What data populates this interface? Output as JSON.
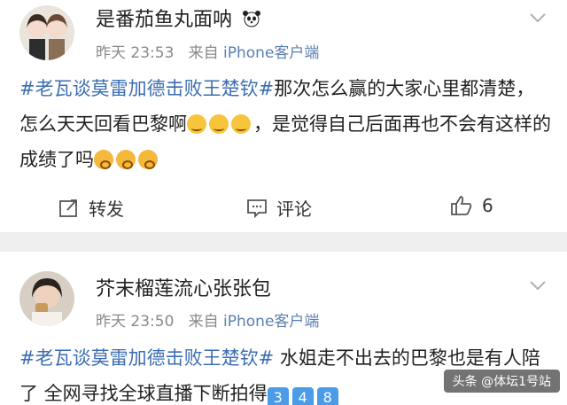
{
  "posts": [
    {
      "username": "是番茄鱼丸面呐",
      "time": "昨天 23:53",
      "source_prefix": "来自",
      "client": "iPhone客户端",
      "hashtag": "#老瓦谈莫雷加德击败王楚钦#",
      "text_a": "那次怎么赢的大家心里都清楚，怎么天天回看巴黎啊",
      "text_b": "，是觉得自己后面再也不会有这样的成绩了吗",
      "repost_label": "转发",
      "comment_label": "评论",
      "like_count": "6"
    },
    {
      "username": "芥末榴莲流心张张包",
      "time": "昨天 23:50",
      "source_prefix": "来自",
      "client": "iPhone客户端",
      "hashtag": "#老瓦谈莫雷加德击败王楚钦#",
      "text_a": " 水姐走不出去的巴黎也是有人陪了  全网寻找全球直播下断拍得",
      "num_badges": [
        "3",
        "4",
        "8"
      ]
    }
  ],
  "watermark": "头条 @体坛1号站",
  "colors": {
    "link": "#3c6db1",
    "meta": "#8a8a8a",
    "client": "#5a7fb0"
  }
}
